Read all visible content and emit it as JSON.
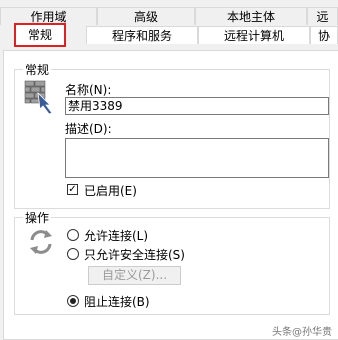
{
  "tabs_row1": [
    {
      "label": "作用域"
    },
    {
      "label": "高级"
    },
    {
      "label": "本地主体"
    },
    {
      "label": "远"
    }
  ],
  "tabs_row2": [
    {
      "label": "常规",
      "active": true
    },
    {
      "label": "程序和服务"
    },
    {
      "label": "远程计算机"
    },
    {
      "label": "协"
    }
  ],
  "general": {
    "section_label": "常规",
    "name_label": "名称(N):",
    "name_value": "禁用3389",
    "desc_label": "描述(D):",
    "desc_value": "",
    "enabled_label": "已启用(E)",
    "enabled": true
  },
  "action": {
    "section_label": "操作",
    "options": [
      {
        "label": "允许连接(L)",
        "selected": false
      },
      {
        "label": "只允许安全连接(S)",
        "selected": false
      }
    ],
    "customize_label": "自定义(Z)...",
    "block_label": "阻止连接(B)",
    "block_selected": true
  },
  "watermark": "头条@孙华贵",
  "colors": {
    "highlight": "#e02020",
    "panel": "#ffffff",
    "chrome": "#f0f0f0"
  }
}
